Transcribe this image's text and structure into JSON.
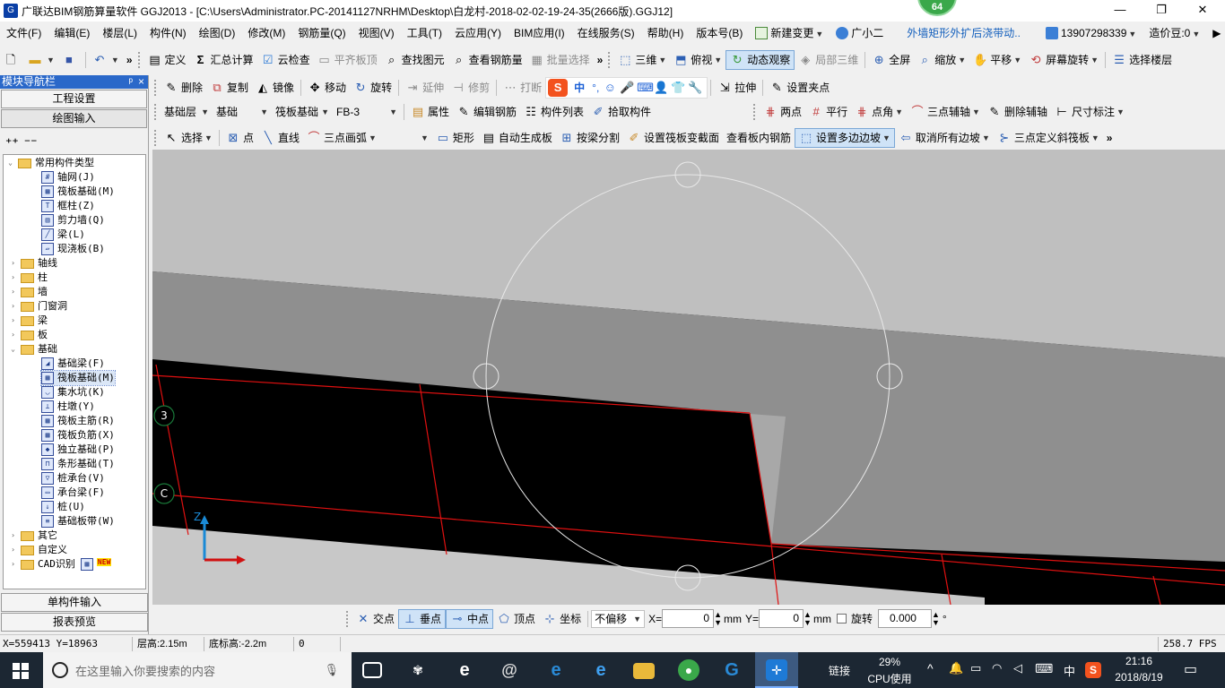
{
  "window": {
    "title": "广联达BIM钢筋算量软件 GGJ2013 - [C:\\Users\\Administrator.PC-20141127NRHM\\Desktop\\白龙村-2018-02-02-19-24-35(2666版).GGJ12]",
    "badge": "64",
    "minimize": "—",
    "restore": "❐",
    "close": "✕"
  },
  "menu": {
    "items": [
      "文件(F)",
      "编辑(E)",
      "楼层(L)",
      "构件(N)",
      "绘图(D)",
      "修改(M)",
      "钢筋量(Q)",
      "视图(V)",
      "工具(T)",
      "云应用(Y)",
      "BIM应用(I)",
      "在线服务(S)",
      "帮助(H)",
      "版本号(B)"
    ],
    "new_change": "新建变更",
    "assistant": "广小二",
    "promo": "外墙矩形外扩后浇带动..",
    "phone": "13907298339",
    "price_beans": "造价豆:0"
  },
  "toolbar1": {
    "define": "定义",
    "sum": "汇总计算",
    "cloud_check": "云检查",
    "flush_top": "平齐板顶",
    "find": "查找图元",
    "view_rebar": "查看钢筋量",
    "batch_select": "批量选择",
    "three_d": "三维",
    "top_view": "俯视",
    "dynamic_view": "动态观察",
    "local_3d": "局部三维",
    "full_screen": "全屏",
    "zoom": "缩放",
    "pan": "平移",
    "screen_rotate": "屏幕旋转",
    "select_floor": "选择楼层"
  },
  "nav": {
    "header": "模块导航栏",
    "pin": "ᵖ",
    "close": "×",
    "project_settings": "工程设置",
    "drawing_input": "绘图输入",
    "single_input": "单构件输入",
    "report_preview": "报表预览"
  },
  "tree": {
    "common": "常用构件类型",
    "common_items": [
      "轴网(J)",
      "筏板基础(M)",
      "框柱(Z)",
      "剪力墙(Q)",
      "梁(L)",
      "现浇板(B)"
    ],
    "folders1": [
      "轴线",
      "柱",
      "墙",
      "门窗洞",
      "梁",
      "板"
    ],
    "foundation": "基础",
    "foundation_items": [
      "基础梁(F)",
      "筏板基础(M)",
      "集水坑(K)",
      "柱墩(Y)",
      "筏板主筋(R)",
      "筏板负筋(X)",
      "独立基础(P)",
      "条形基础(T)",
      "桩承台(V)",
      "承台梁(F)",
      "桩(U)",
      "基础板带(W)"
    ],
    "folders2": [
      "其它",
      "自定义",
      "CAD识别"
    ],
    "new_tag": "NEW"
  },
  "toolbar2": {
    "delete": "删除",
    "copy": "复制",
    "mirror": "镜像",
    "move": "移动",
    "rotate": "旋转",
    "extend": "延伸",
    "trim": "修剪",
    "break": "打断",
    "ime_lang": "中",
    "ime_punct": "°,",
    "stretch": "拉伸",
    "set_grip": "设置夹点"
  },
  "toolbar3": {
    "layer": "基础层",
    "category": "基础",
    "type": "筏板基础",
    "element": "FB-3",
    "property": "属性",
    "edit_rebar": "编辑钢筋",
    "element_list": "构件列表",
    "pick": "拾取构件",
    "two_point": "两点",
    "parallel": "平行",
    "point_angle": "点角",
    "three_point_axis": "三点辅轴",
    "delete_axis": "删除辅轴",
    "dimension": "尺寸标注"
  },
  "toolbar4": {
    "select": "选择",
    "point": "点",
    "line": "直线",
    "arc": "三点画弧",
    "rect": "矩形",
    "auto_gen": "自动生成板",
    "split_by_beam": "按梁分割",
    "set_section": "设置筏板变截面",
    "view_rebar": "查看板内钢筋",
    "set_slope": "设置多边边坡",
    "cancel_slope": "取消所有边坡",
    "three_point_slope": "三点定义斜筏板"
  },
  "viewport": {
    "axis_3": "3",
    "axis_c": "C",
    "axis_z": "Z"
  },
  "snap": {
    "intersection": "交点",
    "perpendicular": "垂点",
    "midpoint": "中点",
    "vertex": "顶点",
    "coordinate": "坐标",
    "offset_mode": "不偏移",
    "x_label": "X=",
    "x_value": "0",
    "x_unit": "mm",
    "y_label": "Y=",
    "y_value": "0",
    "y_unit": "mm",
    "rotate_label": "旋转",
    "rotate_value": "0.000",
    "degree": "°"
  },
  "status": {
    "coords": "X=559413 Y=18963",
    "floor_height": "层高:2.15m",
    "bottom_height": "底标高:-2.2m",
    "count": "0",
    "fps": "258.7 FPS"
  },
  "taskbar": {
    "search_placeholder": "在这里输入你要搜索的内容",
    "link": "链接",
    "cpu_percent": "29%",
    "cpu_label": "CPU使用",
    "ime": "中",
    "time": "21:16",
    "date": "2018/8/19"
  },
  "colors": {
    "selection_blue": "#2a68c9",
    "grid_red": "#e01010",
    "axis_green": "#1a7a3a",
    "taskbar": "#1c2733"
  }
}
